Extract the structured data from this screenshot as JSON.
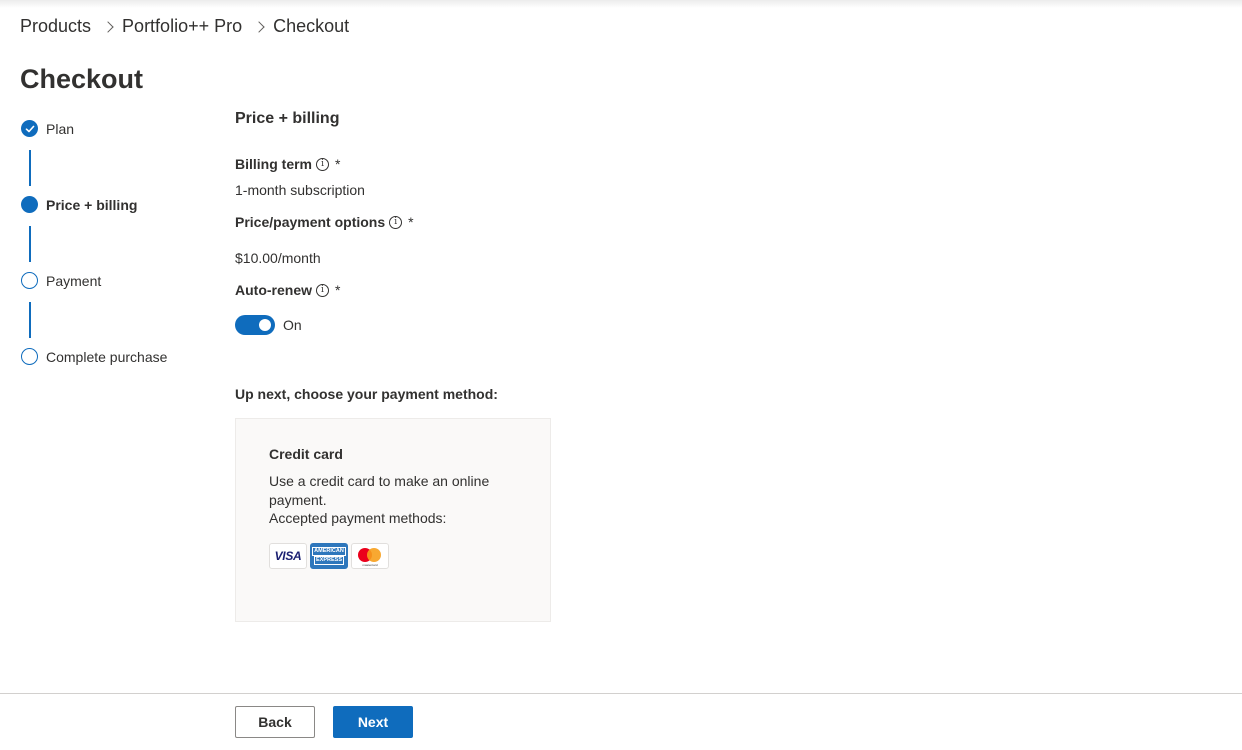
{
  "breadcrumb": {
    "items": [
      "Products",
      "Portfolio++ Pro",
      "Checkout"
    ]
  },
  "page": {
    "title": "Checkout"
  },
  "stepper": {
    "steps": [
      {
        "label": "Plan",
        "state": "done"
      },
      {
        "label": "Price + billing",
        "state": "current"
      },
      {
        "label": "Payment",
        "state": "todo"
      },
      {
        "label": "Complete purchase",
        "state": "todo"
      }
    ]
  },
  "form": {
    "section_title": "Price + billing",
    "billing_term": {
      "label": "Billing term",
      "info_icon": "info-icon",
      "required_mark": "*",
      "value": "1-month subscription"
    },
    "price_options": {
      "label": "Price/payment options",
      "info_icon": "info-icon",
      "required_mark": "*",
      "value": "$10.00/month"
    },
    "auto_renew": {
      "label": "Auto-renew",
      "info_icon": "info-icon",
      "required_mark": "*",
      "state_label": "On",
      "enabled": true
    },
    "up_next": "Up next, choose your payment method:"
  },
  "payment_card": {
    "title": "Credit card",
    "description": "Use a credit card to make an online payment.",
    "accepted": "Accepted payment methods:",
    "logos": {
      "visa": "VISA",
      "amex_line1": "AMERICAN",
      "amex_line2": "EXPRESS",
      "mastercard": "mastercard"
    }
  },
  "footer": {
    "back_label": "Back",
    "next_label": "Next"
  },
  "colors": {
    "accent": "#0f6cbd",
    "text": "#323130",
    "card_bg": "#faf9f8"
  }
}
